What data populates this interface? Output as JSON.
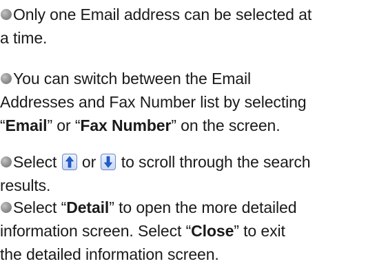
{
  "notes": [
    {
      "lines": [
        "Only one Email address can be selected at",
        "a time."
      ]
    },
    {
      "line1": "You can switch between the Email",
      "line2": "Addresses and Fax Number list by selecting",
      "q1": "“",
      "email": "Email",
      "mid": "” or “",
      "fax": "Fax Number",
      "end": "” on the screen."
    },
    {
      "select": "Select",
      "or": "or",
      "rest": "to scroll through the search",
      "line2": "results.",
      "up_icon": "scroll-up-arrow-icon",
      "down_icon": "scroll-down-arrow-icon"
    },
    {
      "a": "Select “",
      "detail": "Detail",
      "b": "” to open the more detailed",
      "c": "information screen. Select “",
      "close": "Close",
      "d": "” to exit",
      "e": "the detailed information screen."
    }
  ],
  "colors": {
    "text": "#1a1a1a",
    "bullet": "#8f8f8f",
    "arrow": "#1f5fd6"
  }
}
